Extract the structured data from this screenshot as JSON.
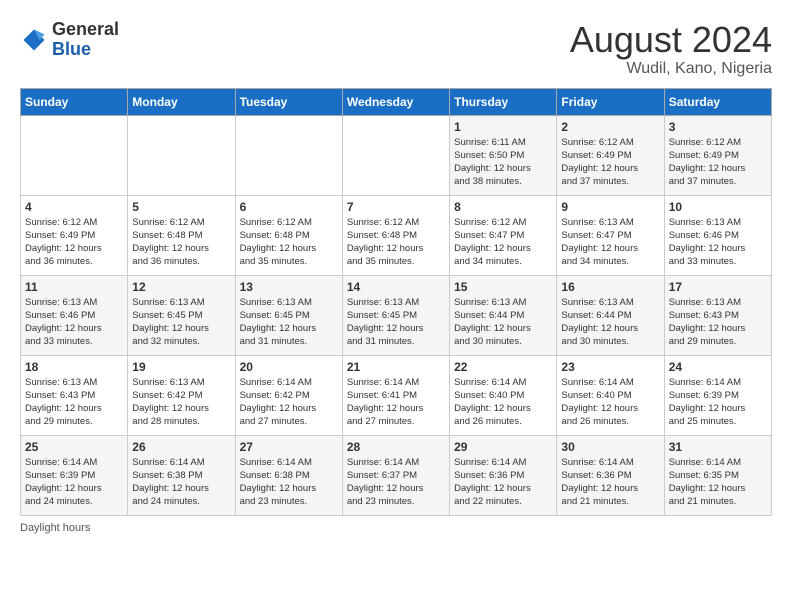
{
  "logo": {
    "general": "General",
    "blue": "Blue"
  },
  "title": "August 2024",
  "subtitle": "Wudil, Kano, Nigeria",
  "days_of_week": [
    "Sunday",
    "Monday",
    "Tuesday",
    "Wednesday",
    "Thursday",
    "Friday",
    "Saturday"
  ],
  "weeks": [
    [
      {
        "day": "",
        "info": ""
      },
      {
        "day": "",
        "info": ""
      },
      {
        "day": "",
        "info": ""
      },
      {
        "day": "",
        "info": ""
      },
      {
        "day": "1",
        "info": "Sunrise: 6:11 AM\nSunset: 6:50 PM\nDaylight: 12 hours\nand 38 minutes."
      },
      {
        "day": "2",
        "info": "Sunrise: 6:12 AM\nSunset: 6:49 PM\nDaylight: 12 hours\nand 37 minutes."
      },
      {
        "day": "3",
        "info": "Sunrise: 6:12 AM\nSunset: 6:49 PM\nDaylight: 12 hours\nand 37 minutes."
      }
    ],
    [
      {
        "day": "4",
        "info": "Sunrise: 6:12 AM\nSunset: 6:49 PM\nDaylight: 12 hours\nand 36 minutes."
      },
      {
        "day": "5",
        "info": "Sunrise: 6:12 AM\nSunset: 6:48 PM\nDaylight: 12 hours\nand 36 minutes."
      },
      {
        "day": "6",
        "info": "Sunrise: 6:12 AM\nSunset: 6:48 PM\nDaylight: 12 hours\nand 35 minutes."
      },
      {
        "day": "7",
        "info": "Sunrise: 6:12 AM\nSunset: 6:48 PM\nDaylight: 12 hours\nand 35 minutes."
      },
      {
        "day": "8",
        "info": "Sunrise: 6:12 AM\nSunset: 6:47 PM\nDaylight: 12 hours\nand 34 minutes."
      },
      {
        "day": "9",
        "info": "Sunrise: 6:13 AM\nSunset: 6:47 PM\nDaylight: 12 hours\nand 34 minutes."
      },
      {
        "day": "10",
        "info": "Sunrise: 6:13 AM\nSunset: 6:46 PM\nDaylight: 12 hours\nand 33 minutes."
      }
    ],
    [
      {
        "day": "11",
        "info": "Sunrise: 6:13 AM\nSunset: 6:46 PM\nDaylight: 12 hours\nand 33 minutes."
      },
      {
        "day": "12",
        "info": "Sunrise: 6:13 AM\nSunset: 6:45 PM\nDaylight: 12 hours\nand 32 minutes."
      },
      {
        "day": "13",
        "info": "Sunrise: 6:13 AM\nSunset: 6:45 PM\nDaylight: 12 hours\nand 31 minutes."
      },
      {
        "day": "14",
        "info": "Sunrise: 6:13 AM\nSunset: 6:45 PM\nDaylight: 12 hours\nand 31 minutes."
      },
      {
        "day": "15",
        "info": "Sunrise: 6:13 AM\nSunset: 6:44 PM\nDaylight: 12 hours\nand 30 minutes."
      },
      {
        "day": "16",
        "info": "Sunrise: 6:13 AM\nSunset: 6:44 PM\nDaylight: 12 hours\nand 30 minutes."
      },
      {
        "day": "17",
        "info": "Sunrise: 6:13 AM\nSunset: 6:43 PM\nDaylight: 12 hours\nand 29 minutes."
      }
    ],
    [
      {
        "day": "18",
        "info": "Sunrise: 6:13 AM\nSunset: 6:43 PM\nDaylight: 12 hours\nand 29 minutes."
      },
      {
        "day": "19",
        "info": "Sunrise: 6:13 AM\nSunset: 6:42 PM\nDaylight: 12 hours\nand 28 minutes."
      },
      {
        "day": "20",
        "info": "Sunrise: 6:14 AM\nSunset: 6:42 PM\nDaylight: 12 hours\nand 27 minutes."
      },
      {
        "day": "21",
        "info": "Sunrise: 6:14 AM\nSunset: 6:41 PM\nDaylight: 12 hours\nand 27 minutes."
      },
      {
        "day": "22",
        "info": "Sunrise: 6:14 AM\nSunset: 6:40 PM\nDaylight: 12 hours\nand 26 minutes."
      },
      {
        "day": "23",
        "info": "Sunrise: 6:14 AM\nSunset: 6:40 PM\nDaylight: 12 hours\nand 26 minutes."
      },
      {
        "day": "24",
        "info": "Sunrise: 6:14 AM\nSunset: 6:39 PM\nDaylight: 12 hours\nand 25 minutes."
      }
    ],
    [
      {
        "day": "25",
        "info": "Sunrise: 6:14 AM\nSunset: 6:39 PM\nDaylight: 12 hours\nand 24 minutes."
      },
      {
        "day": "26",
        "info": "Sunrise: 6:14 AM\nSunset: 6:38 PM\nDaylight: 12 hours\nand 24 minutes."
      },
      {
        "day": "27",
        "info": "Sunrise: 6:14 AM\nSunset: 6:38 PM\nDaylight: 12 hours\nand 23 minutes."
      },
      {
        "day": "28",
        "info": "Sunrise: 6:14 AM\nSunset: 6:37 PM\nDaylight: 12 hours\nand 23 minutes."
      },
      {
        "day": "29",
        "info": "Sunrise: 6:14 AM\nSunset: 6:36 PM\nDaylight: 12 hours\nand 22 minutes."
      },
      {
        "day": "30",
        "info": "Sunrise: 6:14 AM\nSunset: 6:36 PM\nDaylight: 12 hours\nand 21 minutes."
      },
      {
        "day": "31",
        "info": "Sunrise: 6:14 AM\nSunset: 6:35 PM\nDaylight: 12 hours\nand 21 minutes."
      }
    ]
  ],
  "footer": "Daylight hours"
}
